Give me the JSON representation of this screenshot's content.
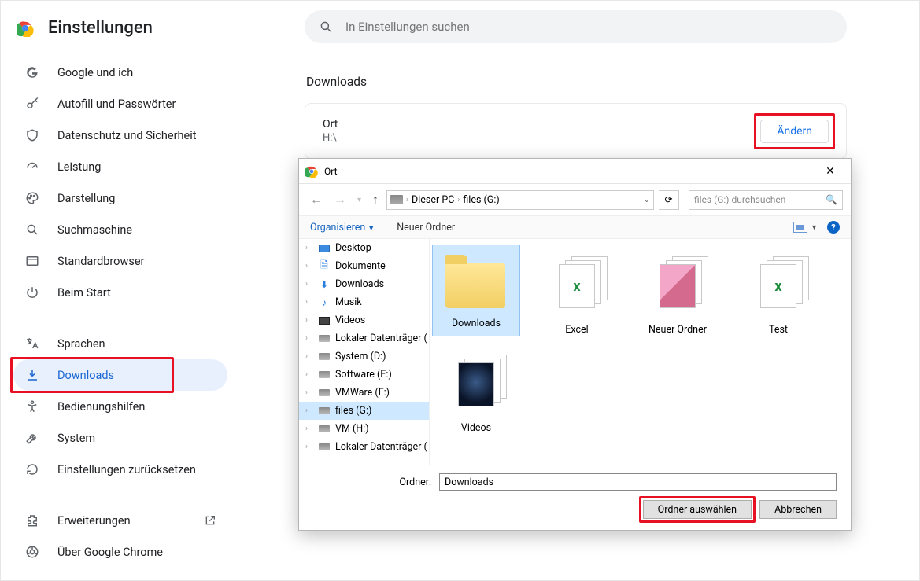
{
  "brand": {
    "title": "Einstellungen"
  },
  "search": {
    "placeholder": "In Einstellungen suchen"
  },
  "sidebar": {
    "items": [
      {
        "label": "Google und ich"
      },
      {
        "label": "Autofill und Passwörter"
      },
      {
        "label": "Datenschutz und Sicherheit"
      },
      {
        "label": "Leistung"
      },
      {
        "label": "Darstellung"
      },
      {
        "label": "Suchmaschine"
      },
      {
        "label": "Standardbrowser"
      },
      {
        "label": "Beim Start"
      },
      {
        "label": "Sprachen"
      },
      {
        "label": "Downloads"
      },
      {
        "label": "Bedienungshilfen"
      },
      {
        "label": "System"
      },
      {
        "label": "Einstellungen zurücksetzen"
      }
    ],
    "ext": "Erweiterungen",
    "about": "Über Google Chrome"
  },
  "section": {
    "title": "Downloads",
    "location_label": "Ort",
    "location_value": "H:\\",
    "change": "Ändern"
  },
  "dialog": {
    "title": "Ort",
    "crumb1": "Dieser PC",
    "crumb2": "files (G:)",
    "search_placeholder": "files (G:) durchsuchen",
    "organize": "Organisieren",
    "new_folder": "Neuer Ordner",
    "tree": [
      {
        "label": "Desktop",
        "icon": "desktop"
      },
      {
        "label": "Dokumente",
        "icon": "doc"
      },
      {
        "label": "Downloads",
        "icon": "down"
      },
      {
        "label": "Musik",
        "icon": "music"
      },
      {
        "label": "Videos",
        "icon": "video"
      },
      {
        "label": "Lokaler Datenträger (",
        "icon": "drive"
      },
      {
        "label": "System (D:)",
        "icon": "drive"
      },
      {
        "label": "Software (E:)",
        "icon": "drive"
      },
      {
        "label": "VMWare (F:)",
        "icon": "drive"
      },
      {
        "label": "files (G:)",
        "icon": "drive",
        "selected": true
      },
      {
        "label": "VM (H:)",
        "icon": "drive"
      },
      {
        "label": "Lokaler Datenträger (",
        "icon": "drive"
      }
    ],
    "files": [
      {
        "label": "Downloads",
        "type": "folder",
        "selected": true
      },
      {
        "label": "Excel",
        "type": "stack-excel"
      },
      {
        "label": "Neuer Ordner",
        "type": "stack-image"
      },
      {
        "label": "Test",
        "type": "stack-excel"
      },
      {
        "label": "Videos",
        "type": "stack-video"
      }
    ],
    "folder_label": "Ordner:",
    "folder_value": "Downloads",
    "select": "Ordner auswählen",
    "cancel": "Abbrechen"
  }
}
